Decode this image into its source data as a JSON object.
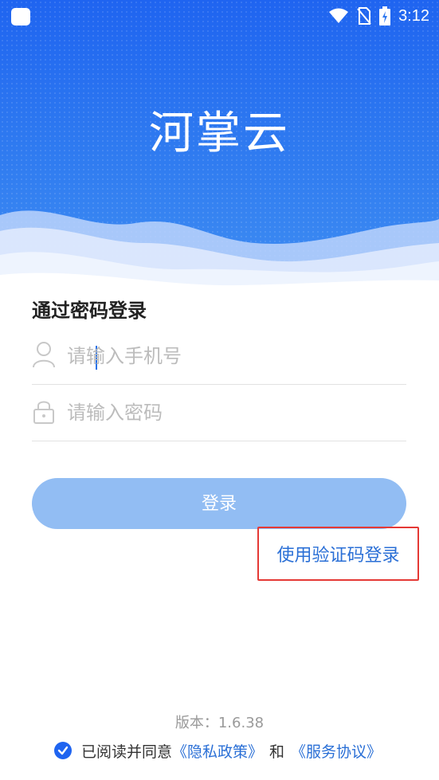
{
  "status_bar": {
    "time": "3:12",
    "icons": [
      "app-notification-icon",
      "wifi-icon",
      "no-sim-icon",
      "battery-charging-icon"
    ]
  },
  "header": {
    "app_title": "河掌云"
  },
  "login": {
    "heading": "通过密码登录",
    "phone_placeholder": "请输入手机号",
    "password_placeholder": "请输入密码",
    "submit_label": "登录",
    "switch_label": "使用验证码登录"
  },
  "footer": {
    "version_text": "版本：1.6.38",
    "agree_prefix": "已阅读并同意",
    "privacy_link": "《隐私政策》",
    "and_text": "和",
    "service_link": "《服务协议》",
    "agreed": true
  },
  "colors": {
    "primary": "#1f64f0",
    "button_disabled": "#92bdf3",
    "link": "#2a6fd6",
    "highlight_box": "#e53935"
  }
}
